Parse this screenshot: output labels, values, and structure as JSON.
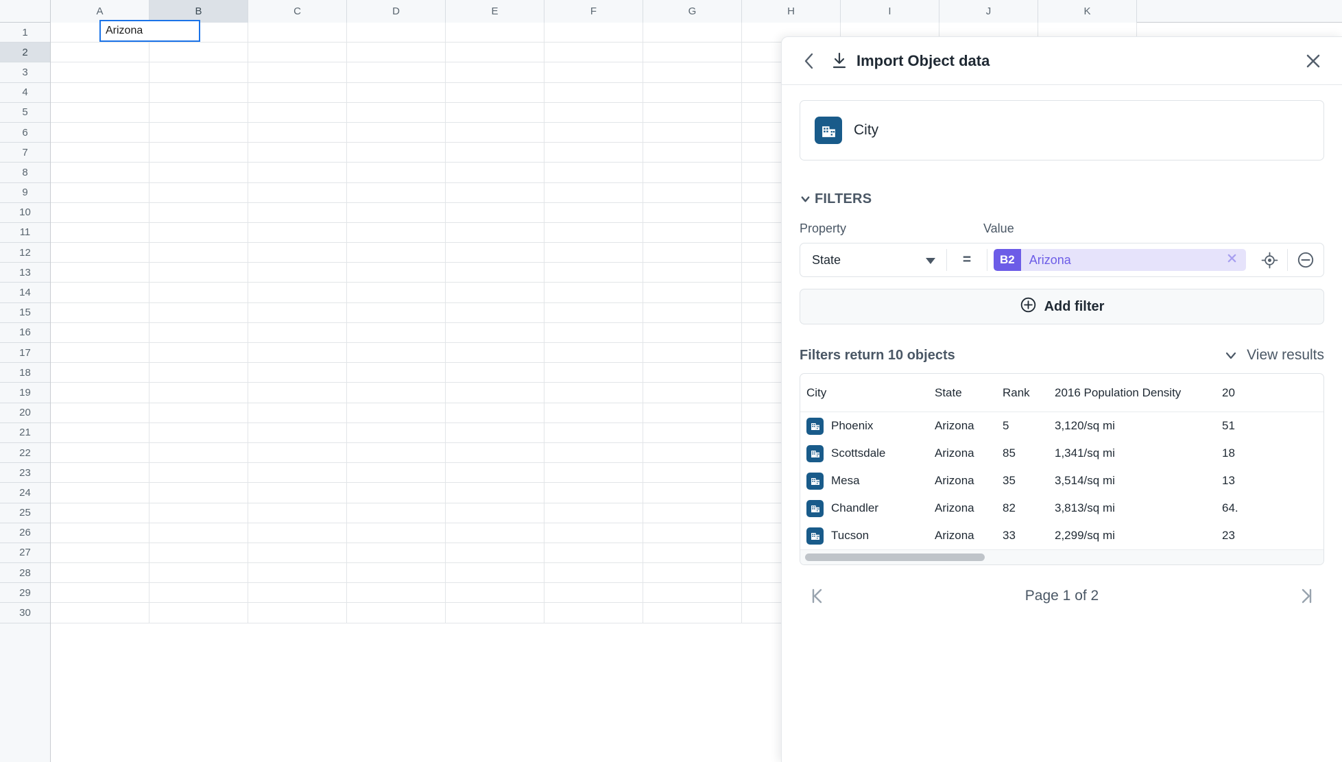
{
  "spreadsheet": {
    "columns": [
      "A",
      "B",
      "C",
      "D",
      "E",
      "F",
      "G",
      "H",
      "I",
      "J",
      "K"
    ],
    "selected_column": "B",
    "rows": [
      "1",
      "2",
      "3",
      "4",
      "5",
      "6",
      "7",
      "8",
      "9",
      "10",
      "11",
      "12",
      "13",
      "14",
      "15",
      "16",
      "17",
      "18",
      "19",
      "20",
      "21",
      "22",
      "23",
      "24",
      "25",
      "26",
      "27",
      "28",
      "29",
      "30"
    ],
    "selected_row": "2",
    "selected_cell": {
      "ref": "B2",
      "value": "Arizona"
    }
  },
  "panel": {
    "header": {
      "back_icon": "chevron-left-icon",
      "download_icon": "download-icon",
      "title": "Import Object data",
      "close_icon": "close-icon"
    },
    "object": {
      "icon": "building-icon",
      "name": "City"
    },
    "filters": {
      "section_label": "FILTERS",
      "collapse_icon": "chevron-down-icon",
      "property_label": "Property",
      "value_label": "Value",
      "rows": [
        {
          "property": "State",
          "property_caret": "caret-down-icon",
          "operator": "=",
          "value_ref": "B2",
          "value_text": "Arizona",
          "clear_icon": "close-icon",
          "picker_icon": "target-icon",
          "remove_icon": "minus-circle-icon"
        }
      ],
      "add_filter": {
        "icon": "plus-circle-icon",
        "label": "Add filter"
      }
    },
    "results": {
      "count_text": "Filters return 10 objects",
      "view_results_label": "View results",
      "view_results_icon": "chevron-down-icon",
      "columns": [
        "City",
        "State",
        "Rank",
        "2016 Population Density",
        "20"
      ],
      "rows": [
        {
          "icon": "building-icon",
          "city": "Phoenix",
          "state": "Arizona",
          "rank": "5",
          "density": "3,120/sq mi",
          "population": "51"
        },
        {
          "icon": "building-icon",
          "city": "Scottsdale",
          "state": "Arizona",
          "rank": "85",
          "density": "1,341/sq mi",
          "population": "18"
        },
        {
          "icon": "building-icon",
          "city": "Mesa",
          "state": "Arizona",
          "rank": "35",
          "density": "3,514/sq mi",
          "population": "13"
        },
        {
          "icon": "building-icon",
          "city": "Chandler",
          "state": "Arizona",
          "rank": "82",
          "density": "3,813/sq mi",
          "population": "64."
        },
        {
          "icon": "building-icon",
          "city": "Tucson",
          "state": "Arizona",
          "rank": "33",
          "density": "2,299/sq mi",
          "population": "23"
        }
      ],
      "scroll_thumb_percent": 35
    },
    "pagination": {
      "first_icon": "page-first-icon",
      "label": "Page 1 of 2",
      "last_icon": "page-last-icon"
    }
  },
  "colors": {
    "accent_blue": "#1a73e8",
    "object_blue": "#195b8a",
    "chip_purple": "#6c5ce7",
    "chip_purple_bg": "#e6e3fb",
    "slate": "#4a5765"
  }
}
